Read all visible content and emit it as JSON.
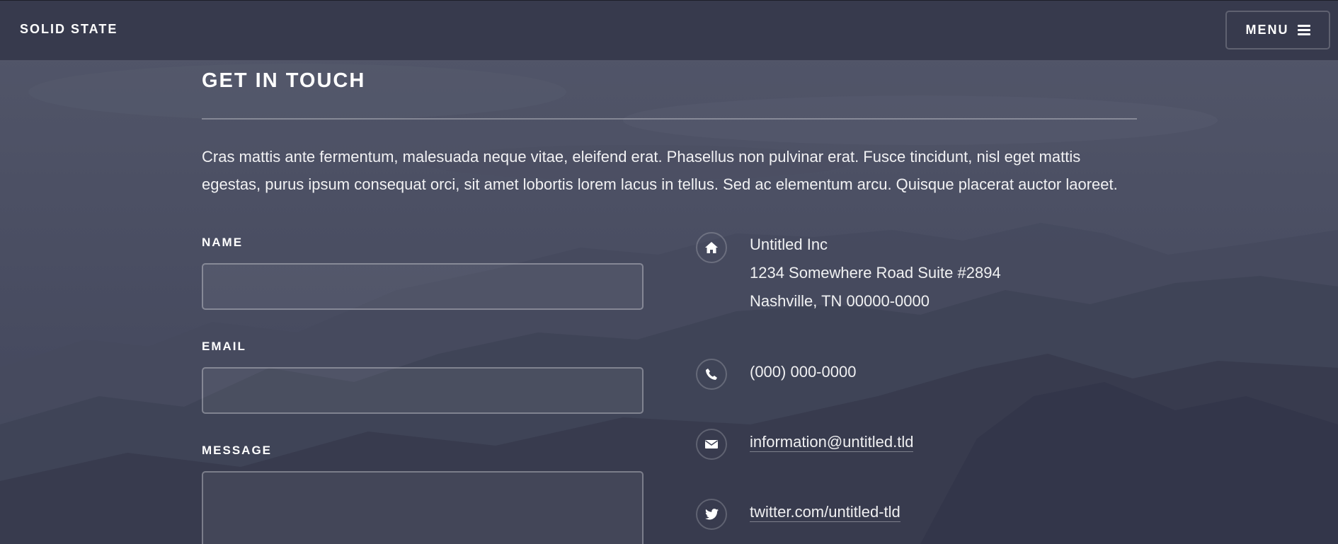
{
  "header": {
    "brand": "SOLID STATE",
    "menu_label": "MENU",
    "menu_icon": "hamburger-icon"
  },
  "section": {
    "title": "GET IN TOUCH",
    "intro": "Cras mattis ante fermentum, malesuada neque vitae, eleifend erat. Phasellus non pulvinar erat. Fusce tincidunt, nisl eget mattis egestas, purus ipsum consequat orci, sit amet lobortis lorem lacus in tellus. Sed ac elementum arcu. Quisque placerat auctor laoreet."
  },
  "form": {
    "name_label": "NAME",
    "name_value": "",
    "email_label": "EMAIL",
    "email_value": "",
    "message_label": "MESSAGE",
    "message_value": ""
  },
  "contact": {
    "address": {
      "icon": "home-icon",
      "line1": "Untitled Inc",
      "line2": "1234 Somewhere Road Suite #2894",
      "line3": "Nashville, TN 00000-0000"
    },
    "phone": {
      "icon": "phone-icon",
      "text": "(000) 000-0000"
    },
    "email": {
      "icon": "envelope-icon",
      "text": "information@untitled.tld"
    },
    "twitter": {
      "icon": "twitter-icon",
      "text": "twitter.com/untitled-tld"
    }
  },
  "colors": {
    "header_bg": "#36394c",
    "page_bg": "#3c4053",
    "text": "#ffffff"
  }
}
